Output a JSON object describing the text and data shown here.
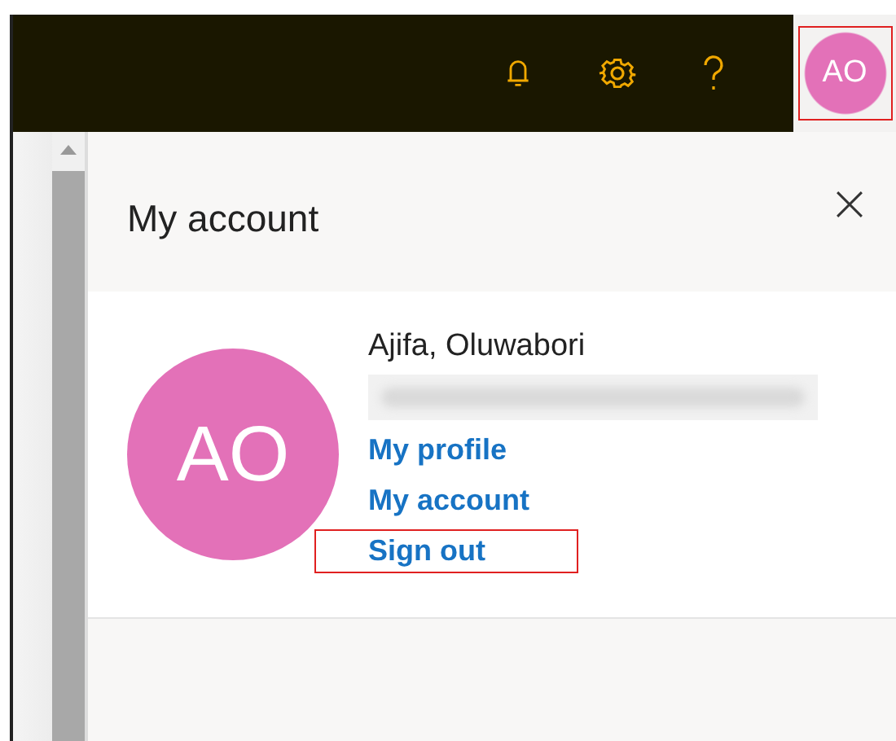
{
  "top_bar": {
    "avatar": {
      "initials": "AO",
      "highlighted": true
    }
  },
  "panel": {
    "title": "My account",
    "user": {
      "initials": "AO",
      "name": "Ajifa, Oluwabori",
      "email_redacted": true
    },
    "links": [
      {
        "label": "My profile",
        "highlighted": false
      },
      {
        "label": "My account",
        "highlighted": false
      },
      {
        "label": "Sign out",
        "highlighted": true
      }
    ]
  }
}
